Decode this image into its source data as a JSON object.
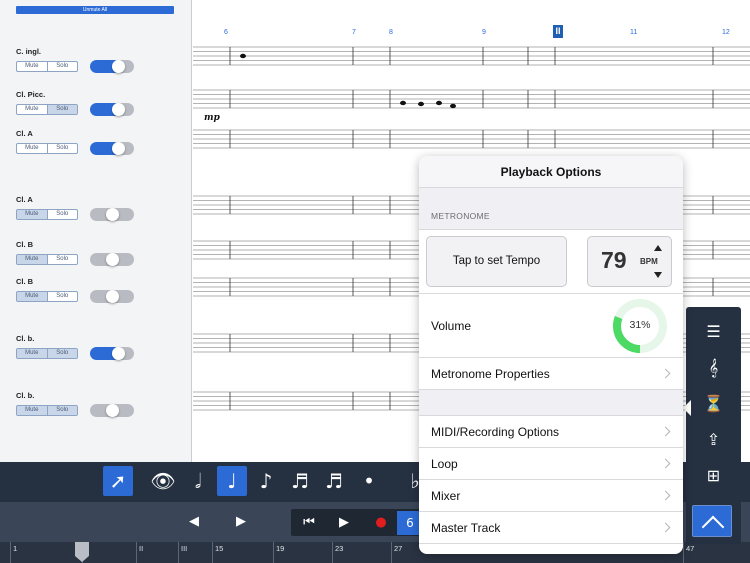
{
  "tracks_panel": {
    "unmute_all": "Unmute All",
    "mute_label": "Mute",
    "solo_label": "Solo",
    "tracks": [
      {
        "name": "C. ingl.",
        "enabled": true
      },
      {
        "name": "Cl. Picc.",
        "enabled": true
      },
      {
        "name": "Cl. A",
        "enabled": true
      },
      {
        "name": "Cl. A",
        "enabled": false
      },
      {
        "name": "Cl. B",
        "enabled": false
      },
      {
        "name": "Cl. B",
        "enabled": false
      },
      {
        "name": "Cl. b.",
        "enabled": true
      },
      {
        "name": "Cl. b.",
        "enabled": false
      }
    ]
  },
  "score": {
    "measure_numbers": [
      "6",
      "7",
      "8",
      "9",
      "11",
      "12"
    ],
    "cursor_label": "II",
    "dynamic": "mp"
  },
  "playback_options": {
    "title": "Playback Options",
    "metronome_header": "METRONOME",
    "tap_tempo": "Tap to set Tempo",
    "bpm_value": "79",
    "bpm_unit": "BPM",
    "volume_label": "Volume",
    "volume_percent": 31,
    "volume_text": "31%",
    "metronome_properties": "Metronome Properties",
    "midi_recording": "MIDI/Recording Options",
    "loop": "Loop",
    "mixer": "Mixer",
    "master_track": "Master Track",
    "accent_color": "#4cd964"
  },
  "transport": {
    "counter_text": "6"
  },
  "timeline": {
    "numbers": [
      "1",
      "I",
      "II",
      "III",
      "15",
      "19",
      "23",
      "27",
      "47"
    ]
  },
  "colors": {
    "accent": "#2c6bd6",
    "toolbar": "#253040"
  }
}
